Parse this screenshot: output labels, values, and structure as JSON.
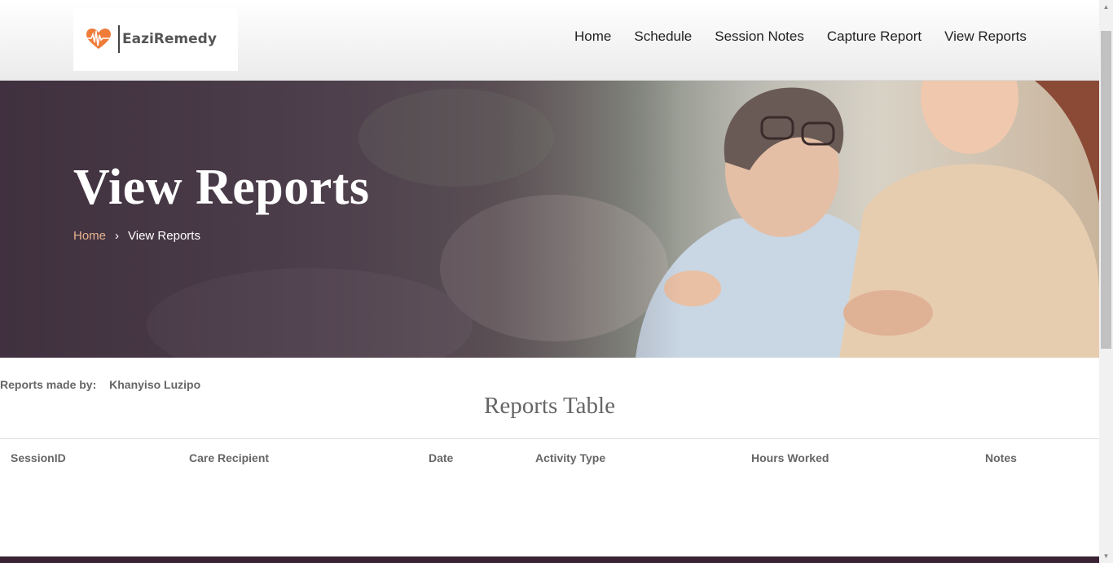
{
  "brand": {
    "name": "EaziRemedy",
    "accent": "#f07c3a"
  },
  "nav": {
    "items": [
      {
        "label": "Home"
      },
      {
        "label": "Schedule"
      },
      {
        "label": "Session Notes"
      },
      {
        "label": "Capture Report"
      },
      {
        "label": "View Reports"
      }
    ]
  },
  "hero": {
    "title": "View Reports",
    "breadcrumb": {
      "home": "Home",
      "separator": "›",
      "current": "View Reports"
    }
  },
  "report": {
    "made_by_label": "Reports made by:",
    "made_by_name": "Khanyiso Luzipo",
    "table_title": "Reports Table",
    "columns": [
      "SessionID",
      "Care Recipient",
      "Date",
      "Activity Type",
      "Hours Worked",
      "Notes"
    ],
    "rows": []
  },
  "colors": {
    "breadcrumb_home": "#e7b28e",
    "footer": "#3a2433"
  }
}
